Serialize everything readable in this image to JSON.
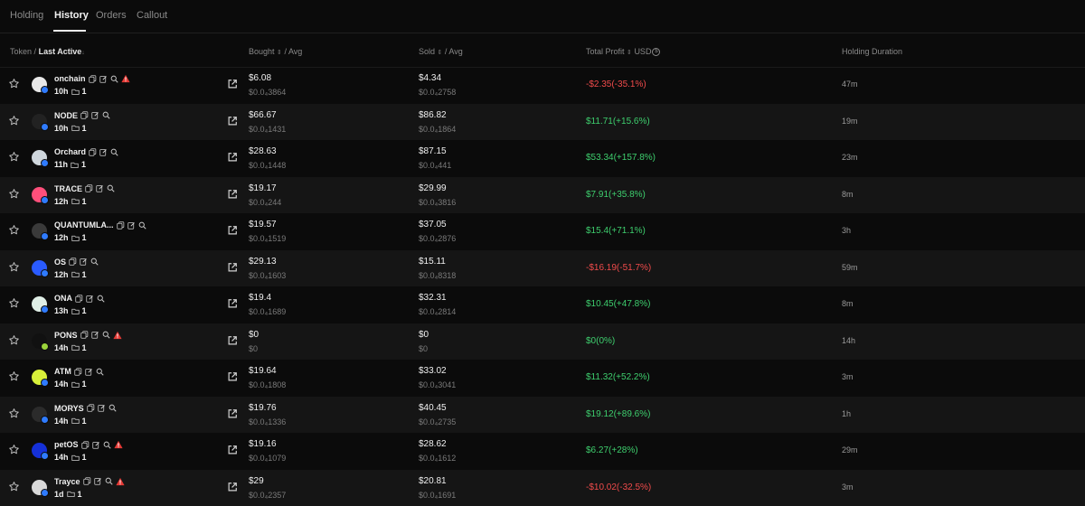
{
  "tabs": [
    {
      "label": "Holding"
    },
    {
      "label": "History"
    },
    {
      "label": "Orders"
    },
    {
      "label": "Callout"
    }
  ],
  "active_tab": "History",
  "header": {
    "token": "Token",
    "slash": "/",
    "last_active": "Last Active",
    "bought": "Bought",
    "bought_avg": "/ Avg",
    "sold": "Sold",
    "sold_avg": "/ Avg",
    "total_profit": "Total Profit",
    "usd": "USD",
    "holding_duration": "Holding Duration"
  },
  "colors": {
    "positive": "#3ecf6e",
    "negative": "#f04b4b",
    "background": "#0b0b0b"
  },
  "rows": [
    {
      "name": "onchain",
      "time": "10h",
      "count": "1",
      "warning": true,
      "bought": "$6.08",
      "bought_avg": "$0.0₄3864",
      "sold": "$4.34",
      "sold_avg": "$0.0₄2758",
      "profit": "-$2.35(-35.1%)",
      "profit_sign": "neg",
      "duration": "47m",
      "avatar_color": "#e8e8e8",
      "badge": "blue"
    },
    {
      "name": "NODE",
      "time": "10h",
      "count": "1",
      "warning": false,
      "bought": "$66.67",
      "bought_avg": "$0.0₄1431",
      "sold": "$86.82",
      "sold_avg": "$0.0₄1864",
      "profit": "$11.71(+15.6%)",
      "profit_sign": "pos",
      "duration": "19m",
      "avatar_color": "#222222",
      "badge": "blue"
    },
    {
      "name": "Orchard",
      "time": "11h",
      "count": "1",
      "warning": false,
      "bought": "$28.63",
      "bought_avg": "$0.0₄1448",
      "sold": "$87.15",
      "sold_avg": "$0.0₄441",
      "profit": "$53.34(+157.8%)",
      "profit_sign": "pos",
      "duration": "23m",
      "avatar_color": "#cfd6dc",
      "badge": "blue"
    },
    {
      "name": "TRACE",
      "time": "12h",
      "count": "1",
      "warning": false,
      "bought": "$19.17",
      "bought_avg": "$0.0₄244",
      "sold": "$29.99",
      "sold_avg": "$0.0₄3816",
      "profit": "$7.91(+35.8%)",
      "profit_sign": "pos",
      "duration": "8m",
      "avatar_color": "#ff4f7b",
      "badge": "blue"
    },
    {
      "name": "QUANTUMLA...",
      "time": "12h",
      "count": "1",
      "warning": false,
      "bought": "$19.57",
      "bought_avg": "$0.0₄1519",
      "sold": "$37.05",
      "sold_avg": "$0.0₄2876",
      "profit": "$15.4(+71.1%)",
      "profit_sign": "pos",
      "duration": "3h",
      "avatar_color": "#3a3a3a",
      "badge": "blue"
    },
    {
      "name": "OS",
      "time": "12h",
      "count": "1",
      "warning": false,
      "bought": "$29.13",
      "bought_avg": "$0.0₄1603",
      "sold": "$15.11",
      "sold_avg": "$0.0₄8318",
      "profit": "-$16.19(-51.7%)",
      "profit_sign": "neg",
      "duration": "59m",
      "avatar_color": "#2a5bff",
      "badge": "blue"
    },
    {
      "name": "ONA",
      "time": "13h",
      "count": "1",
      "warning": false,
      "bought": "$19.4",
      "bought_avg": "$0.0₄1689",
      "sold": "$32.31",
      "sold_avg": "$0.0₄2814",
      "profit": "$10.45(+47.8%)",
      "profit_sign": "pos",
      "duration": "8m",
      "avatar_color": "#dfeee6",
      "badge": "blue"
    },
    {
      "name": "PONS",
      "time": "14h",
      "count": "1",
      "warning": true,
      "bought": "$0",
      "bought_avg": "$0",
      "sold": "$0",
      "sold_avg": "$0",
      "profit": "$0(0%)",
      "profit_sign": "pos",
      "duration": "14h",
      "avatar_color": "#111111",
      "badge": "green"
    },
    {
      "name": "ATM",
      "time": "14h",
      "count": "1",
      "warning": false,
      "bought": "$19.64",
      "bought_avg": "$0.0₄1808",
      "sold": "$33.02",
      "sold_avg": "$0.0₄3041",
      "profit": "$11.32(+52.2%)",
      "profit_sign": "pos",
      "duration": "3m",
      "avatar_color": "#d8f03a",
      "badge": "blue"
    },
    {
      "name": "MORYS",
      "time": "14h",
      "count": "1",
      "warning": false,
      "bought": "$19.76",
      "bought_avg": "$0.0₄1336",
      "sold": "$40.45",
      "sold_avg": "$0.0₄2735",
      "profit": "$19.12(+89.6%)",
      "profit_sign": "pos",
      "duration": "1h",
      "avatar_color": "#2b2b2b",
      "badge": "blue"
    },
    {
      "name": "petOS",
      "time": "14h",
      "count": "1",
      "warning": true,
      "bought": "$19.16",
      "bought_avg": "$0.0₄1079",
      "sold": "$28.62",
      "sold_avg": "$0.0₄1612",
      "profit": "$6.27(+28%)",
      "profit_sign": "pos",
      "duration": "29m",
      "avatar_color": "#1530d8",
      "badge": "blue"
    },
    {
      "name": "Trayce",
      "time": "1d",
      "count": "1",
      "warning": true,
      "bought": "$29",
      "bought_avg": "$0.0₄2357",
      "sold": "$20.81",
      "sold_avg": "$0.0₄1691",
      "profit": "-$10.02(-32.5%)",
      "profit_sign": "neg",
      "duration": "3m",
      "avatar_color": "#d9d9d9",
      "badge": "blue"
    }
  ]
}
